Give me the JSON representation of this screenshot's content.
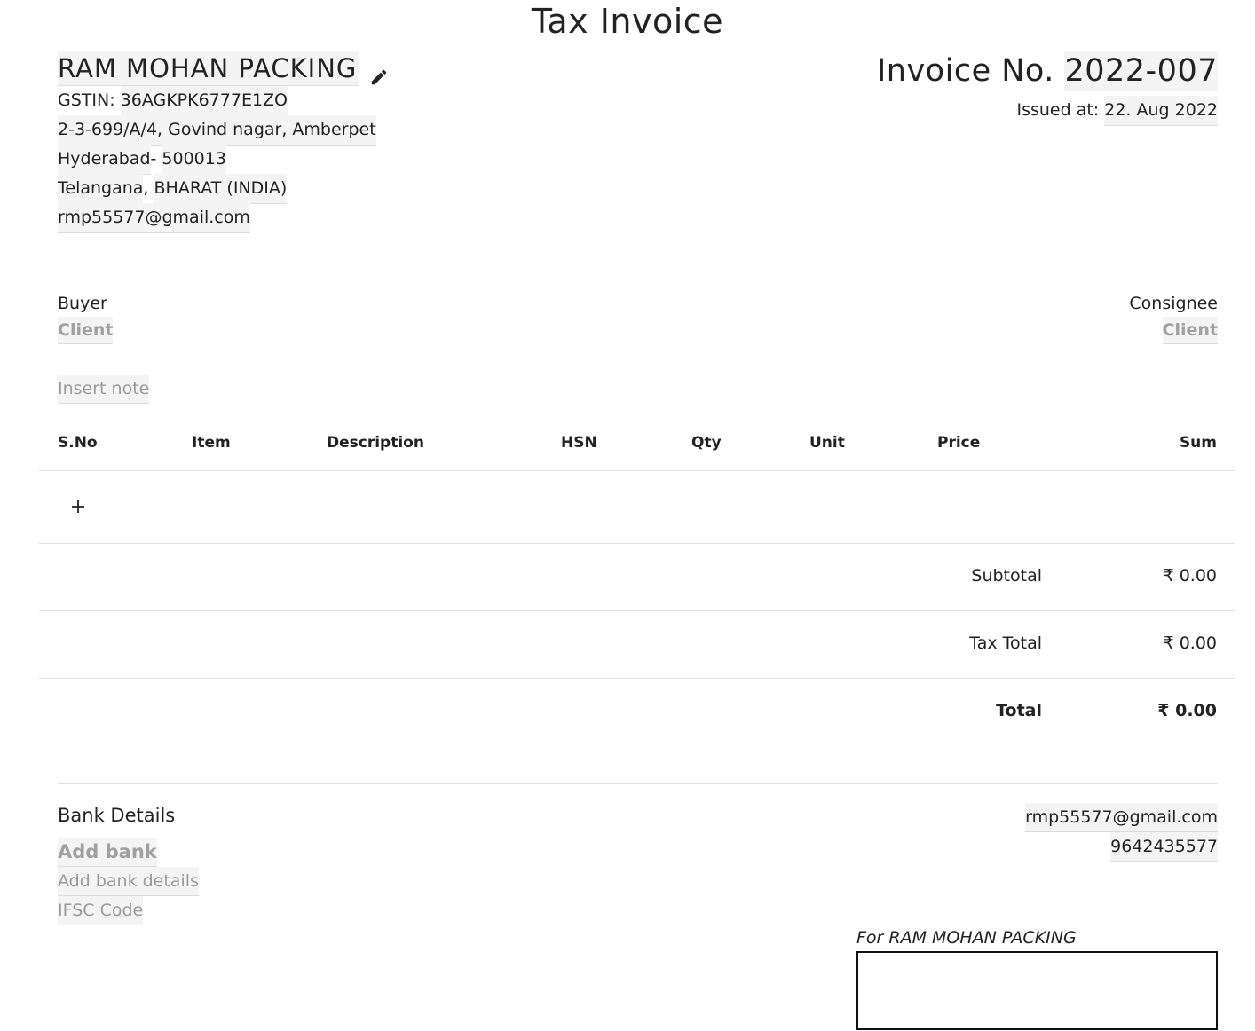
{
  "document": {
    "title": "Tax Invoice"
  },
  "seller": {
    "name": "RAM MOHAN PACKING",
    "gstin_label": "GSTIN:",
    "gstin": "36AGKPK6777E1ZO",
    "address_line": "2-3-699/A/4, Govind nagar, Amberpet",
    "city": "Hyderabad",
    "city_separator": "- ",
    "pincode": "500013",
    "state": "Telangana",
    "state_separator": ", ",
    "country": "BHARAT (INDIA)",
    "email": "rmp55577@gmail.com",
    "edit_icon": "pencil-icon"
  },
  "invoice": {
    "number_label": "Invoice No.",
    "number": "2022-007",
    "issued_label": "Issued at:",
    "issued_date": "22. Aug 2022"
  },
  "buyer": {
    "label": "Buyer",
    "client_placeholder": "Client"
  },
  "consignee": {
    "label": "Consignee",
    "client_placeholder": "Client"
  },
  "note": {
    "placeholder": "Insert note"
  },
  "table": {
    "columns": [
      "S.No",
      "Item",
      "Description",
      "HSN",
      "Qty",
      "Unit",
      "Price",
      "Sum"
    ],
    "rows": [],
    "add_row_icon": "plus-icon"
  },
  "totals": {
    "subtotal_label": "Subtotal",
    "subtotal": "₹ 0.00",
    "tax_label": "Tax Total",
    "tax": "₹ 0.00",
    "total_label": "Total",
    "total": "₹ 0.00"
  },
  "bank": {
    "title": "Bank Details",
    "add_bank_placeholder": "Add bank",
    "details_placeholder": "Add bank details",
    "ifsc_placeholder": "IFSC Code"
  },
  "contact": {
    "email": "rmp55577@gmail.com",
    "phone": "9642435577"
  },
  "signature": {
    "for_label": "For RAM MOHAN PACKING"
  }
}
